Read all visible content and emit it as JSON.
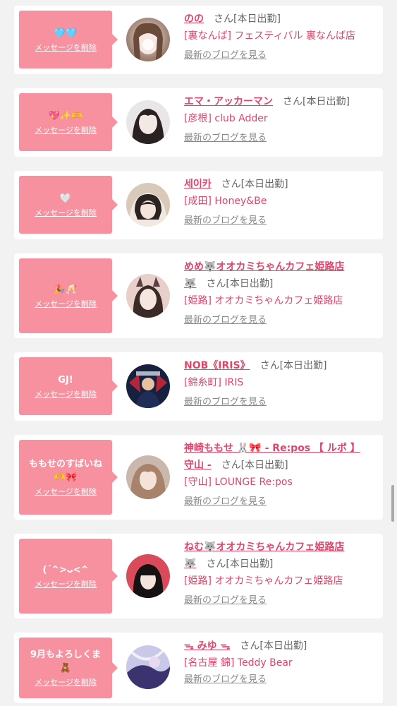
{
  "delete_label": "メッセージを削除",
  "blog_label": "最新のブログを見る",
  "san_suffix": "さん[本日出勤]",
  "colors": {
    "accent": "#e0456a",
    "bubble": "#f7919f"
  },
  "entries": [
    {
      "message": "🩵🩵",
      "name": "のの",
      "name_cont": "",
      "shop": "[裏なんば] フェスティバル 裏なんば店"
    },
    {
      "message": "💖✨🫶",
      "name": "エマ・アッカーマン",
      "name_cont": "",
      "shop": "[彦根] club Adder"
    },
    {
      "message": "🤍",
      "name": "세이카",
      "name_cont": "",
      "shop": "[成田] Honey&Be"
    },
    {
      "message": "🎉🥂",
      "name": "めめ🐺オオカミちゃんカフェ姫路店",
      "name_cont": "🐺",
      "shop": "[姫路] オオカミちゃんカフェ姫路店"
    },
    {
      "message": "GJ!",
      "name": "NOB《IRIS》",
      "name_cont": "",
      "shop": "[錦糸町] IRIS"
    },
    {
      "message": "ももせのすばいね",
      "message2": "🫶🎀",
      "name": "神崎ももせ 🐰🎀 - Re:pos 【 ルポ 】",
      "name_cont": "守山 -",
      "shop": "[守山] LOUNGE Re:pos"
    },
    {
      "message": "(´^>ᴗ<^",
      "name": "ねむ🐺オオカミちゃんカフェ姫路店",
      "name_cont": "🐺",
      "shop": "[姫路] オオカミちゃんカフェ姫路店"
    },
    {
      "message": "9月もよろしくま",
      "message2": "🧸",
      "name": "ᯓ みゆ ᯓ",
      "name_cont": "",
      "shop": "[名古屋 錦] Teddy Bear"
    }
  ]
}
